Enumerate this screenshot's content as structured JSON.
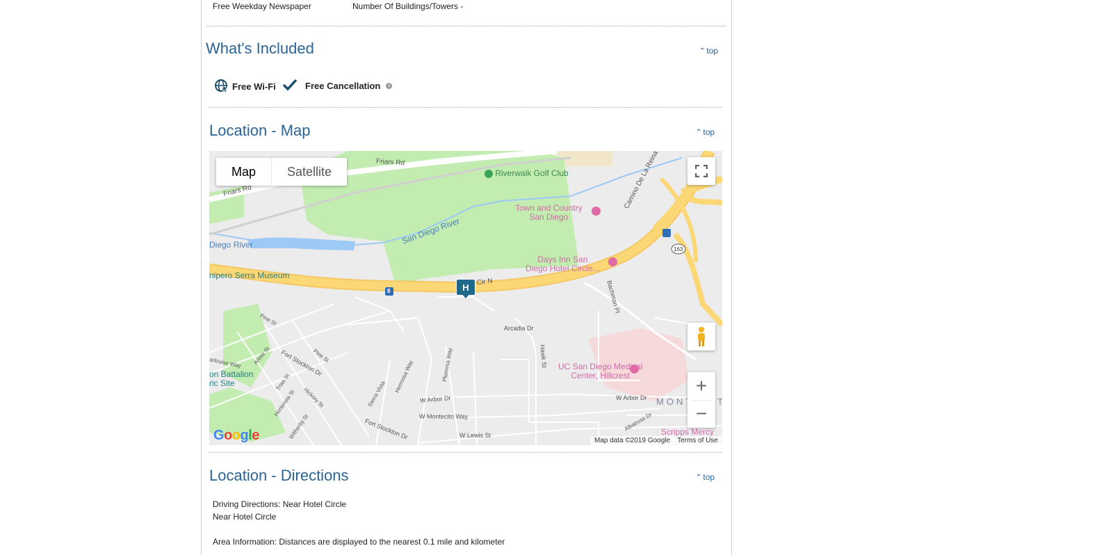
{
  "amenities_row": {
    "left": "Free Weekday Newspaper",
    "right": "Number Of Buildings/Towers -"
  },
  "whats_included": {
    "title": "What's Included",
    "top_link": "top",
    "items": [
      {
        "label": "Free Wi-Fi",
        "icon": "wifi-globe-icon"
      },
      {
        "label": "Free Cancellation",
        "icon": "checkmark-icon"
      }
    ]
  },
  "location_map": {
    "title": "Location - Map",
    "top_link": "top",
    "map_type": {
      "map": "Map",
      "satellite": "Satellite"
    },
    "zoom": {
      "in": "+",
      "out": "−"
    },
    "labels": {
      "friars_rd_top": "Friars Rd",
      "friars_rd_left": "Friars Rd",
      "riverwalk": "Riverwalk Golf Club",
      "town_country": "Town and Country\nSan Diego",
      "san_diego_river": "San Diego River",
      "diego_river": "Diego River",
      "days_inn": "Days Inn San\nDiego Hotel Circle...",
      "serra_museum": "nipero Serra Museum",
      "cir_n": "Cir N",
      "camino": "Camino De La Reina",
      "bachman": "Bachman Pl",
      "arcadia": "Arcadia Dr",
      "hawk": "Hawk St",
      "ucsd": "UC San Diego Medical\nCenter, Hillcrest",
      "battalion": "on Battalion\nric Site",
      "w_arbor_left": "W Arbor Dr",
      "w_arbor_right": "W Arbor Dr",
      "w_montecito": "W Montecito Way",
      "w_lewis": "W Lewis St",
      "fort_stockton": "Fort Stockton Dr",
      "fort_stockton2": "Fort Stockton Dr",
      "montecito_area": "MONTECIT",
      "scripps": "Scripps Mercy",
      "pine": "Pine St",
      "pine2": "Pine St",
      "arista": "Arista St",
      "trias": "Trias St",
      "hortensia": "Hortensia St",
      "hickory": "Hickory St",
      "witherby": "Witherby St",
      "sierra_vista": "Sierra Vista",
      "hermosa": "Hermosa Way",
      "plumosa": "Plumosa Way",
      "carlouise": "arlouise Way",
      "albatross": "Albatross Dr",
      "i8": "8",
      "ca163": "163",
      "hotel_marker": "H"
    },
    "google_logo": "Google",
    "attribution": "Map data ©2019 Google",
    "terms": "Terms of Use"
  },
  "location_directions": {
    "title": "Location - Directions",
    "top_link": "top",
    "line1": "Driving Directions: Near Hotel Circle",
    "line2": "Near Hotel Circle",
    "line3": "Area Information: Distances are displayed to the nearest 0.1 mile and kilometer"
  },
  "colors": {
    "heading_blue": "#2a6496",
    "highway_yellow": "#fbd775",
    "park_green": "#c2ecb0",
    "water_blue": "#9cc9f5",
    "marker_teal": "#1d6a8a"
  }
}
